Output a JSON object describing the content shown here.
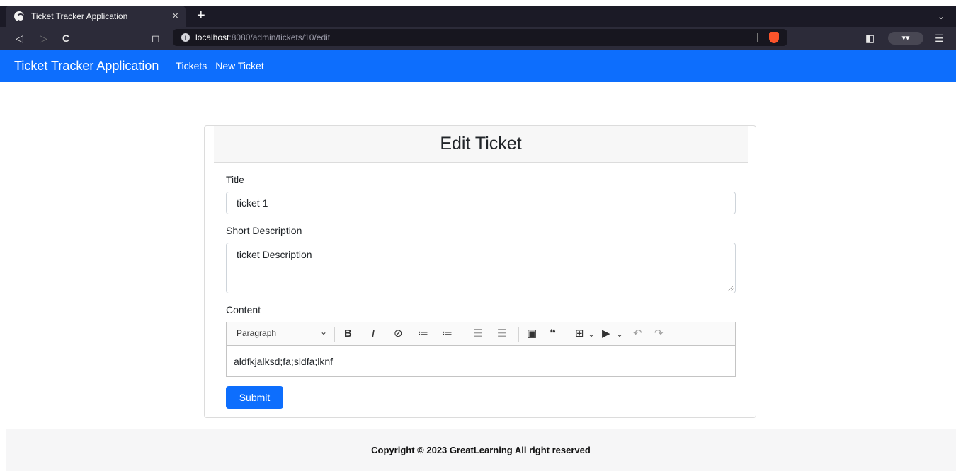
{
  "browser": {
    "tab_title": "Ticket Tracker Application",
    "tab_close": "×",
    "new_tab": "+",
    "tab_list": "⌄",
    "back": "◁",
    "forward": "▷",
    "reload": "C",
    "bookmark": "◻",
    "url_host": "localhost",
    "url_path": ":8080/admin/tickets/10/edit",
    "menu": "☰",
    "sidebar_toggle": "◧",
    "extension": "▾▾"
  },
  "navbar": {
    "brand": "Ticket Tracker Application",
    "links": [
      "Tickets",
      "New Ticket"
    ]
  },
  "form": {
    "heading": "Edit Ticket",
    "title_label": "Title",
    "title_value": "ticket 1",
    "short_description_label": "Short Description",
    "short_description_value": "ticket Description",
    "content_label": "Content",
    "editor": {
      "heading_select": "Paragraph",
      "content": "aldfkjalksd;fa;sldfa;lknf"
    },
    "submit_label": "Submit"
  },
  "footer": {
    "text": "Copyright © 2023 GreatLearning All right reserved"
  },
  "colors": {
    "primary": "#0d6efd",
    "chrome_dark": "#1b1a26",
    "chrome_toolbar": "#2c2b39"
  }
}
